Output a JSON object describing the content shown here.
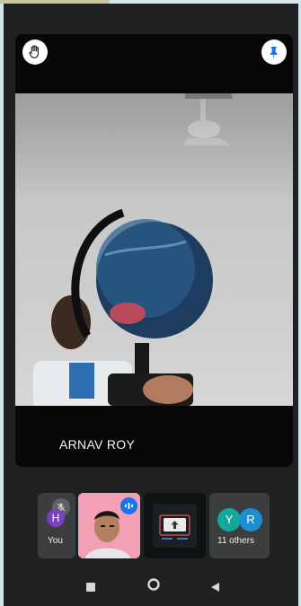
{
  "main_tile": {
    "participant_name": "ARNAV ROY"
  },
  "strip": {
    "self": {
      "initial": "H",
      "label": "You",
      "avatar_color": "#7b3fc4"
    },
    "others": {
      "initials": [
        "Y",
        "R"
      ],
      "label": "11 others",
      "colors": [
        "#12a89a",
        "#1a8fd4"
      ]
    }
  },
  "colors": {
    "accent_blue": "#1a73e8",
    "background": "#1f2021",
    "tile_bg": "#3c3d3f"
  },
  "icons": {
    "raise_hand": "hand-icon",
    "pin": "pin-icon",
    "muted": "mic-off-icon",
    "speaking": "audio-level-icon",
    "present": "present-screen-icon",
    "nav_recents": "square-icon",
    "nav_home": "circle-icon",
    "nav_back": "triangle-back-icon"
  }
}
